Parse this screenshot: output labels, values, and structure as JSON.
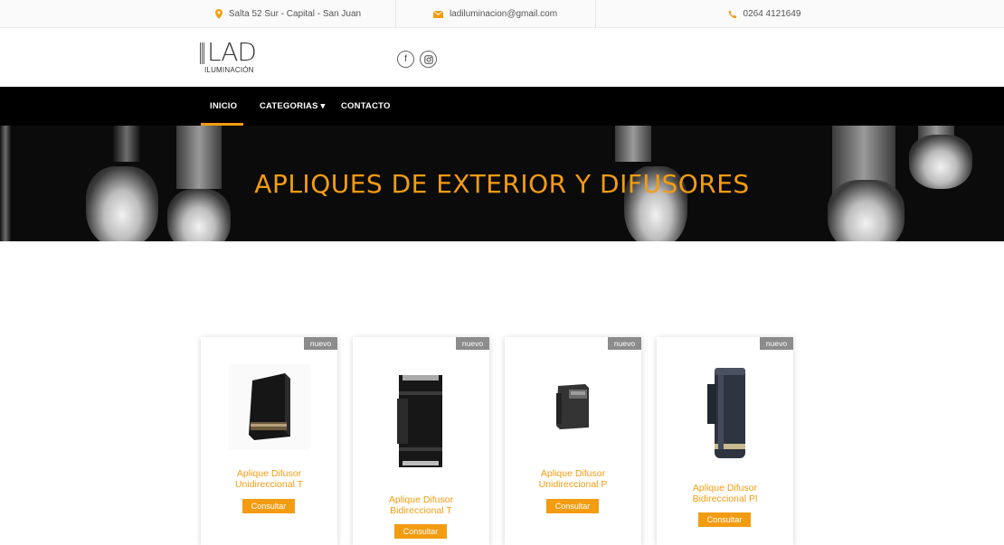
{
  "topbar": {
    "address": "Salta 52 Sur - Capital - San Juan",
    "email": "ladiluminacion@gmail.com",
    "phone": "0264 4121649"
  },
  "logo": {
    "word": "LAD",
    "sub": "ILUMINACIÓN"
  },
  "social": {
    "facebook": "f",
    "instagram": "◙"
  },
  "nav": {
    "items": [
      "INICIO",
      "CATEGORIAS ▾",
      "CONTACTO"
    ]
  },
  "hero": {
    "title": "APLIQUES DE EXTERIOR Y DIFUSORES"
  },
  "colors": {
    "accent": "#f39c12",
    "nav_bg": "#000000",
    "badge": "#8c8c8c"
  },
  "products": [
    {
      "badge": "nuevo",
      "title_line1": "Aplique Difusor",
      "title_line2": "Unidireccional T",
      "button": "Consultar"
    },
    {
      "badge": "nuevo",
      "title_line1": "Aplique Difusor",
      "title_line2": "Bidireccional T",
      "button": "Consultar"
    },
    {
      "badge": "nuevo",
      "title_line1": "Aplique Difusor",
      "title_line2": "Unidireccional P",
      "button": "Consultar"
    },
    {
      "badge": "nuevo",
      "title_line1": "Aplique Difusor",
      "title_line2": "Bidireccional Pl",
      "button": "Consultar"
    }
  ]
}
